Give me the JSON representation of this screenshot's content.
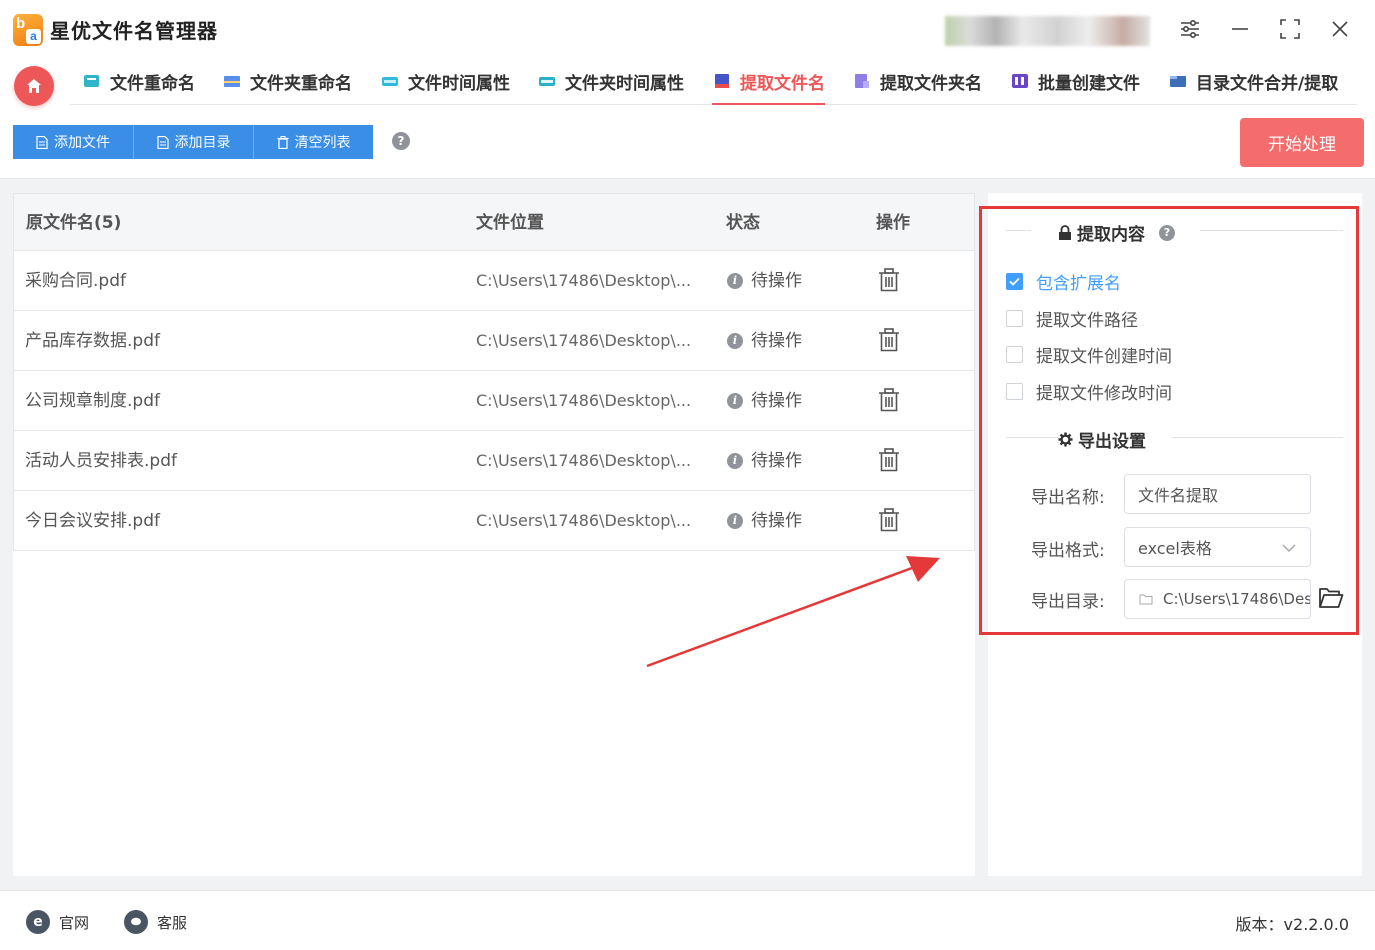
{
  "app": {
    "title": "星优文件名管理器"
  },
  "tabs": [
    {
      "label": "文件重命名"
    },
    {
      "label": "文件夹重命名"
    },
    {
      "label": "文件时间属性"
    },
    {
      "label": "文件夹时间属性"
    },
    {
      "label": "提取文件名",
      "active": true
    },
    {
      "label": "提取文件夹名"
    },
    {
      "label": "批量创建文件"
    },
    {
      "label": "目录文件合并/提取"
    }
  ],
  "toolbar": {
    "add_file": "添加文件",
    "add_dir": "添加目录",
    "clear_list": "清空列表",
    "help": "?",
    "start": "开始处理"
  },
  "table": {
    "headers": {
      "name": "原文件名(5)",
      "location": "文件位置",
      "status": "状态",
      "action": "操作"
    },
    "rows": [
      {
        "name": "采购合同.pdf",
        "location": "C:\\Users\\17486\\Desktop\\...",
        "status": "待操作"
      },
      {
        "name": "产品库存数据.pdf",
        "location": "C:\\Users\\17486\\Desktop\\...",
        "status": "待操作"
      },
      {
        "name": "公司规章制度.pdf",
        "location": "C:\\Users\\17486\\Desktop\\...",
        "status": "待操作"
      },
      {
        "name": "活动人员安排表.pdf",
        "location": "C:\\Users\\17486\\Desktop\\...",
        "status": "待操作"
      },
      {
        "name": "今日会议安排.pdf",
        "location": "C:\\Users\\17486\\Desktop\\...",
        "status": "待操作"
      }
    ]
  },
  "extract": {
    "title": "提取内容",
    "options": [
      {
        "label": "包含扩展名",
        "checked": true
      },
      {
        "label": "提取文件路径",
        "checked": false
      },
      {
        "label": "提取文件创建时间",
        "checked": false
      },
      {
        "label": "提取文件修改时间",
        "checked": false
      }
    ]
  },
  "export": {
    "title": "导出设置",
    "name_label": "导出名称:",
    "name_value": "文件名提取",
    "format_label": "导出格式:",
    "format_value": "excel表格",
    "dir_label": "导出目录:",
    "dir_value": "C:\\Users\\17486\\Des"
  },
  "statusbar": {
    "website": "官网",
    "service": "客服",
    "version": "版本：v2.2.0.0"
  },
  "colors": {
    "accent_red": "#ee5757",
    "button_blue": "#3a8ee6",
    "check_blue": "#409eff",
    "annotation_red": "#e53838"
  }
}
